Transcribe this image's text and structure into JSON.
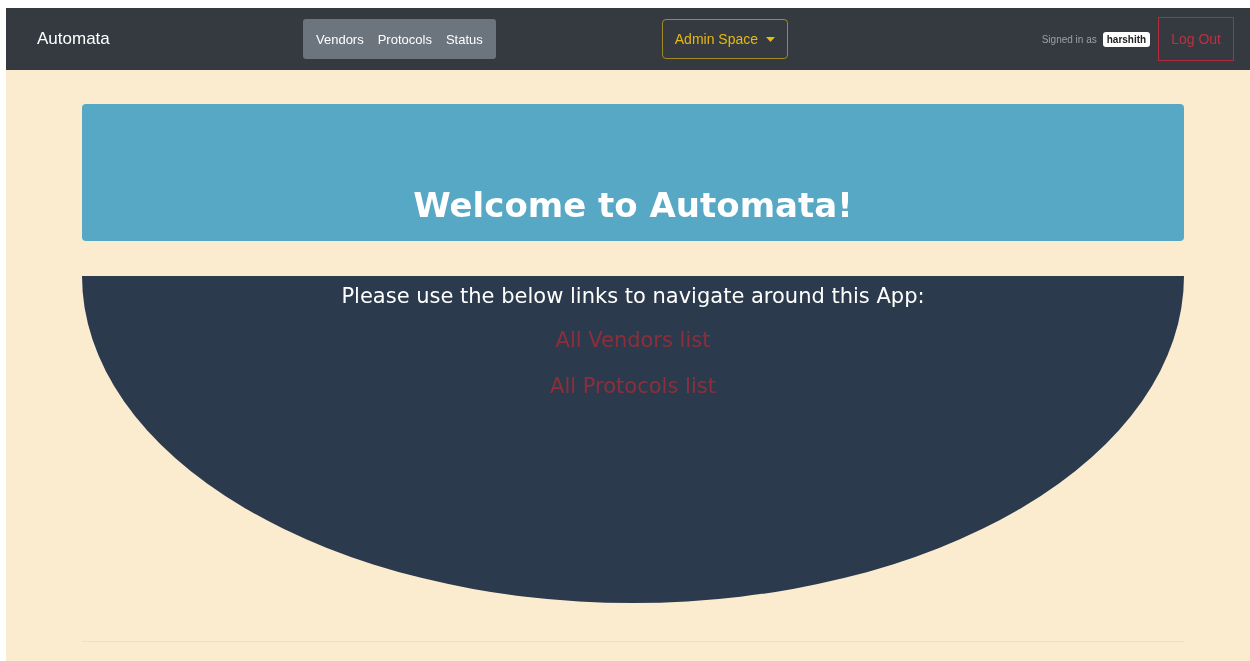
{
  "navbar": {
    "brand": "Automata",
    "links": [
      "Vendors",
      "Protocols",
      "Status"
    ],
    "admin_menu": "Admin Space",
    "signed_in_label": "Signed in as",
    "username": "harshith",
    "logout": "Log Out"
  },
  "banner": {
    "title": "Welcome to Automata!"
  },
  "content": {
    "intro": "Please use the below links to navigate around this App:",
    "links": [
      "All Vendors list",
      "All Protocols list"
    ]
  }
}
